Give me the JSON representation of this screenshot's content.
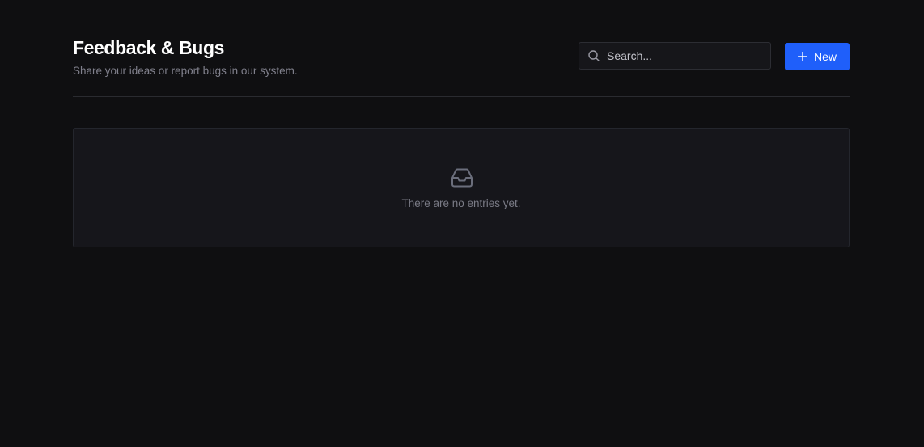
{
  "header": {
    "title": "Feedback & Bugs",
    "subtitle": "Share your ideas or report bugs in our system."
  },
  "search": {
    "placeholder": "Search...",
    "value": "",
    "icon": "search-icon"
  },
  "new_button": {
    "label": "New",
    "icon": "plus-icon"
  },
  "empty_state": {
    "icon": "inbox-icon",
    "message": "There are no entries yet."
  },
  "colors": {
    "background": "#0f0f11",
    "panel": "#16161b",
    "accent": "#1f5ffa",
    "title": "#ffffff",
    "muted_text": "#80808c"
  }
}
